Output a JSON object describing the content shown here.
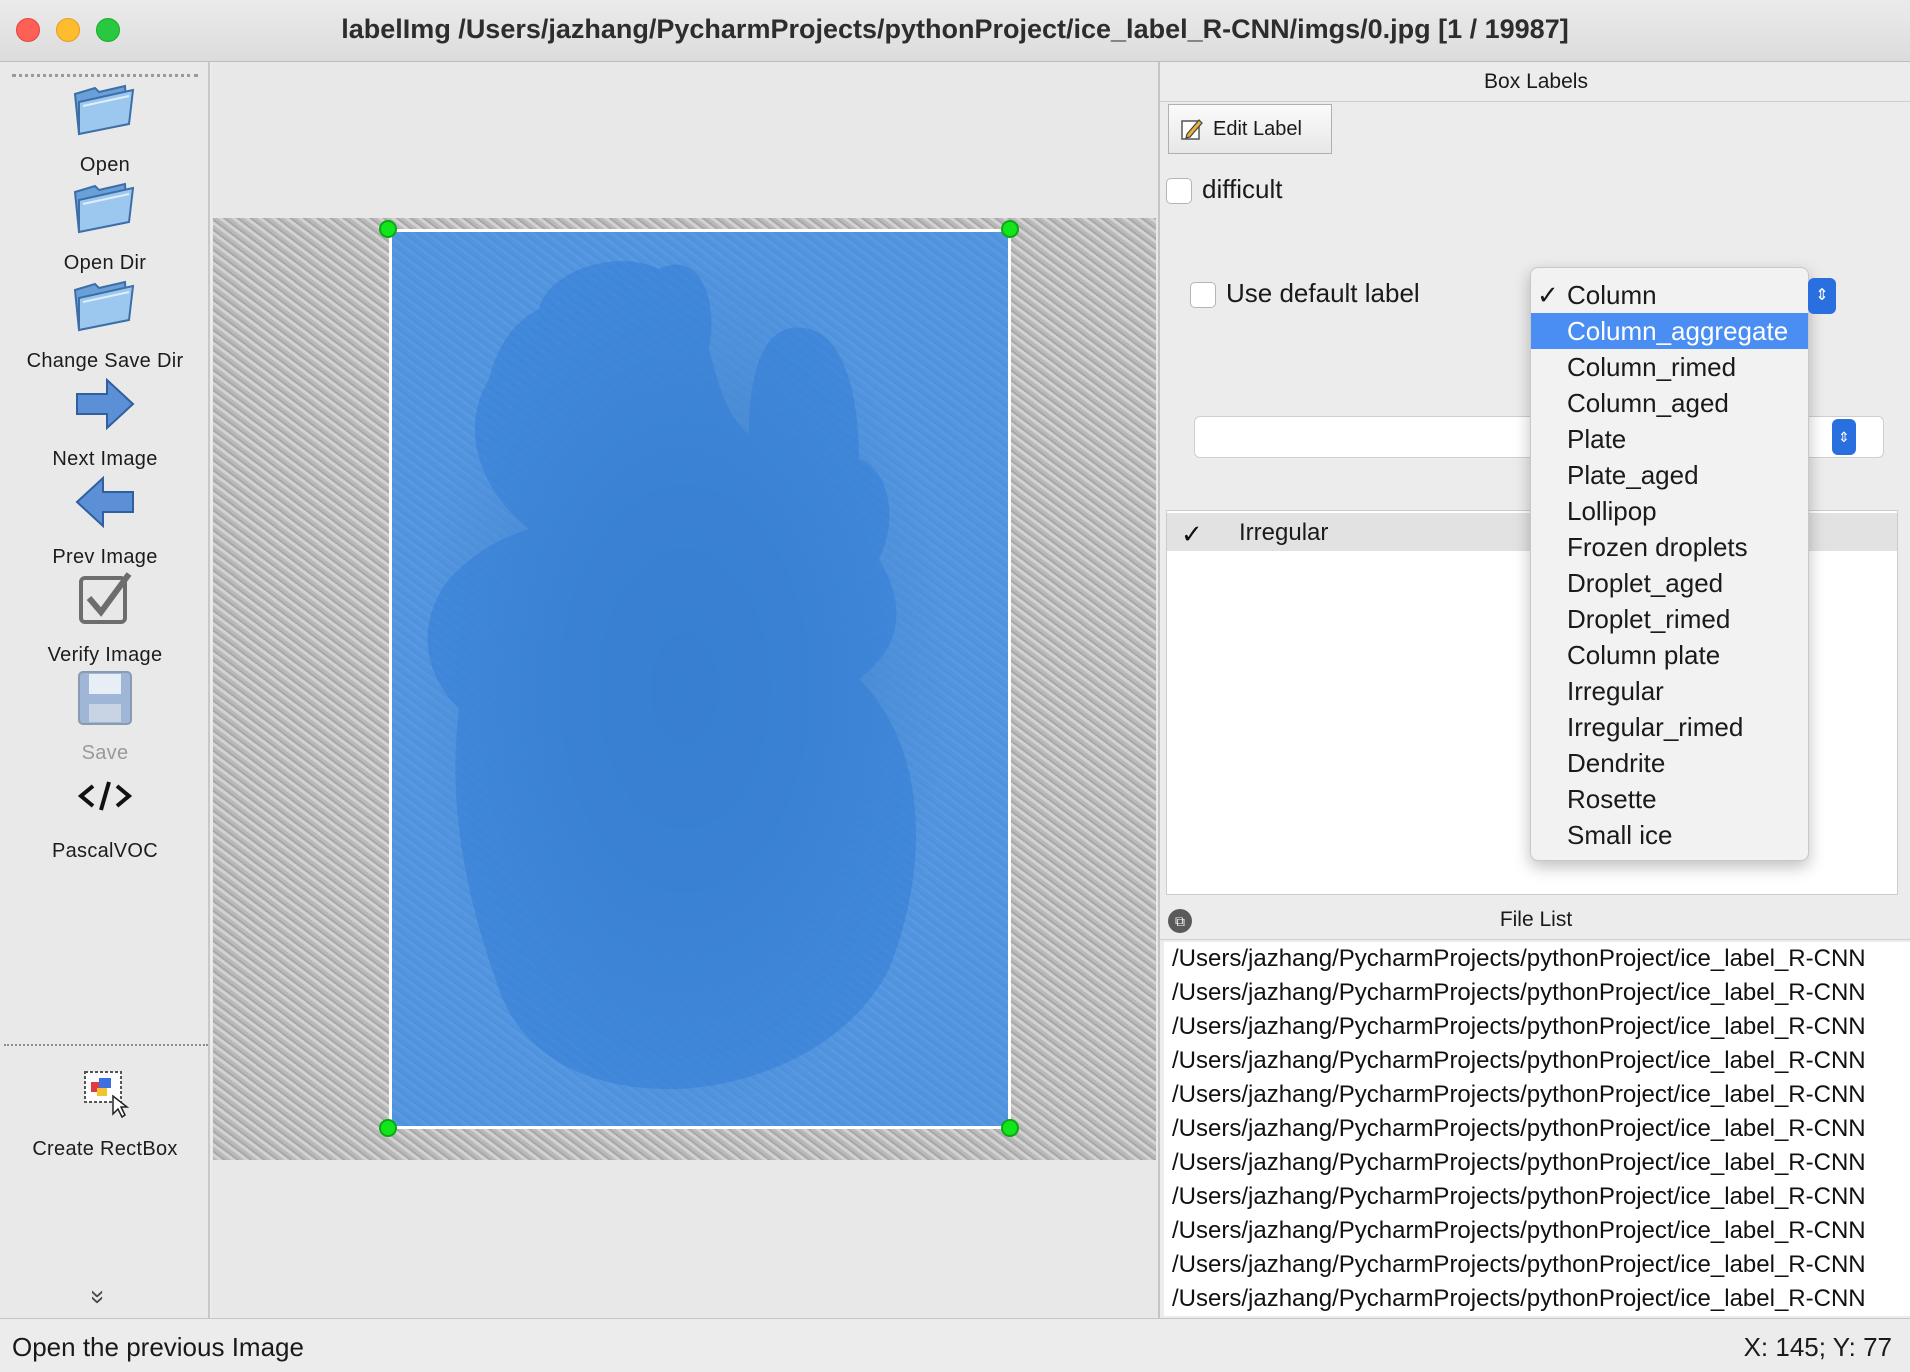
{
  "window": {
    "title": "labelImg /Users/jazhang/PycharmProjects/pythonProject/ice_label_R-CNN/imgs/0.jpg [1 / 19987]"
  },
  "toolbar": {
    "items": [
      {
        "label": "Open",
        "icon": "folder-icon"
      },
      {
        "label": "Open Dir",
        "icon": "folder-icon"
      },
      {
        "label": "Change Save Dir",
        "icon": "folder-icon"
      },
      {
        "label": "Next Image",
        "icon": "arrow-right-icon"
      },
      {
        "label": "Prev Image",
        "icon": "arrow-left-icon"
      },
      {
        "label": "Verify Image",
        "icon": "checkbox-icon"
      },
      {
        "label": "Save",
        "icon": "floppy-disk-icon"
      },
      {
        "label": "PascalVOC",
        "icon": "code-icon"
      },
      {
        "label": "Create RectBox",
        "icon": "rectbox-icon"
      }
    ],
    "more_glyph": "»"
  },
  "box_labels": {
    "title": "Box Labels",
    "edit_label_button": "Edit Label",
    "difficult_label": "difficult",
    "difficult_checked": false,
    "use_default_label": "Use default label",
    "use_default_checked": false,
    "labels": [
      {
        "text": "Irregular",
        "checked": true
      }
    ]
  },
  "label_dropdown": {
    "selected": "Column",
    "highlighted": "Column_aggregate",
    "options": [
      "Column",
      "Column_aggregate",
      "Column_rimed",
      "Column_aged",
      "Plate",
      "Plate_aged",
      "Lollipop",
      "Frozen droplets",
      "Droplet_aged",
      "Droplet_rimed",
      "Column plate",
      "Irregular",
      "Irregular_rimed",
      "Dendrite",
      "Rosette",
      "Small ice"
    ]
  },
  "file_list": {
    "title": "File List",
    "items": [
      "/Users/jazhang/PycharmProjects/pythonProject/ice_label_R-CNN",
      "/Users/jazhang/PycharmProjects/pythonProject/ice_label_R-CNN",
      "/Users/jazhang/PycharmProjects/pythonProject/ice_label_R-CNN",
      "/Users/jazhang/PycharmProjects/pythonProject/ice_label_R-CNN",
      "/Users/jazhang/PycharmProjects/pythonProject/ice_label_R-CNN",
      "/Users/jazhang/PycharmProjects/pythonProject/ice_label_R-CNN",
      "/Users/jazhang/PycharmProjects/pythonProject/ice_label_R-CNN",
      "/Users/jazhang/PycharmProjects/pythonProject/ice_label_R-CNN",
      "/Users/jazhang/PycharmProjects/pythonProject/ice_label_R-CNN",
      "/Users/jazhang/PycharmProjects/pythonProject/ice_label_R-CNN",
      "/Users/jazhang/PycharmProjects/pythonProject/ice_label_R-CNN"
    ]
  },
  "status": {
    "message": "Open the previous Image",
    "coords": "X: 145; Y: 77"
  },
  "colors": {
    "box_fill": "#3c8ce6",
    "handle": "#13e51c",
    "dropdown_highlight": "#4a8ef4",
    "accent": "#2a6fe0"
  }
}
